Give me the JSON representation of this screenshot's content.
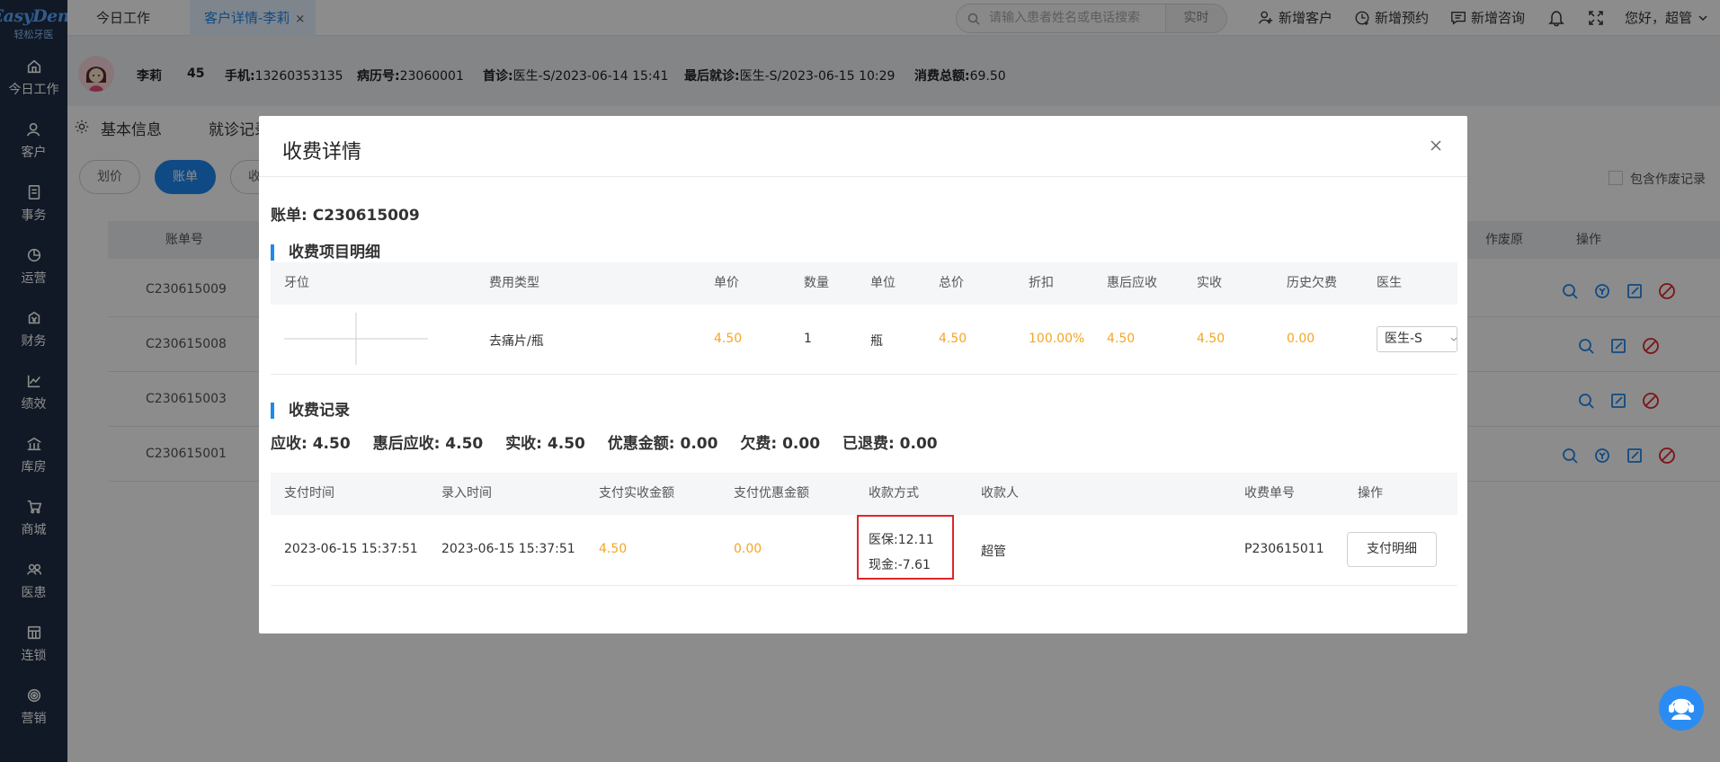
{
  "app": {
    "logo_main": "EasyDent",
    "logo_sub": "轻松牙医"
  },
  "sidebar": {
    "items": [
      {
        "label": "今日工作",
        "icon": "home-icon"
      },
      {
        "label": "客户",
        "icon": "customer-icon"
      },
      {
        "label": "事务",
        "icon": "tasks-icon"
      },
      {
        "label": "运营",
        "icon": "operations-icon"
      },
      {
        "label": "财务",
        "icon": "finance-icon"
      },
      {
        "label": "绩效",
        "icon": "performance-icon"
      },
      {
        "label": "库房",
        "icon": "warehouse-icon"
      },
      {
        "label": "商城",
        "icon": "mall-icon"
      },
      {
        "label": "医患",
        "icon": "doctor-patient-icon"
      },
      {
        "label": "连锁",
        "icon": "chain-icon"
      },
      {
        "label": "营销",
        "icon": "marketing-icon"
      }
    ]
  },
  "topbar": {
    "tab_home": "今日工作",
    "tab_active": "客户详情-李莉",
    "tab_close": "×",
    "search_placeholder": "请输入患者姓名或电话搜索",
    "search_mode": "实时",
    "add_customer": "新增客户",
    "add_appointment": "新增预约",
    "add_consult": "新增咨询",
    "greeting": "您好，超管"
  },
  "patient": {
    "name": "李莉",
    "age": "45",
    "phone_label": "手机:",
    "phone": "13260353135",
    "record_label": "病历号:",
    "record_no": "23060001",
    "first_visit_label": "首诊:",
    "first_visit": "医生-S/2023-06-14 15:41",
    "last_visit_label": "最后就诊:",
    "last_visit": "医生-S/2023-06-15 10:29",
    "total_label": "消费总额:",
    "total": "69.50"
  },
  "background": {
    "tabs": [
      "基本信息",
      "就诊记录"
    ],
    "pills": [
      "划价",
      "账单",
      "收"
    ],
    "include_void": "包含作废记录",
    "columns": [
      "账单号",
      "作废原",
      "操作"
    ],
    "rows": [
      "C230615009",
      "C230615008",
      "C230615003",
      "C230615001"
    ]
  },
  "modal": {
    "title": "收费详情",
    "bill_label": "账单: C230615009",
    "items_section": "收费项目明细",
    "items_columns": [
      "牙位",
      "费用类型",
      "单价",
      "数量",
      "单位",
      "总价",
      "折扣",
      "惠后应收",
      "实收",
      "历史欠费",
      "医生"
    ],
    "item": {
      "fee_type": "去痛片/瓶",
      "unit_price": "4.50",
      "quantity": "1",
      "unit": "瓶",
      "total": "4.50",
      "discount": "100.00%",
      "after_discount": "4.50",
      "received": "4.50",
      "history_debt": "0.00",
      "doctor": "医生-S"
    },
    "records_section": "收费记录",
    "summary": {
      "receivable": "应收: 4.50",
      "after_discount": "惠后应收: 4.50",
      "received": "实收: 4.50",
      "discount_amount": "优惠金额: 0.00",
      "debt": "欠费: 0.00",
      "refunded": "已退费: 0.00"
    },
    "records_columns": [
      "支付时间",
      "录入时间",
      "支付实收金额",
      "支付优惠金额",
      "收款方式",
      "收款人",
      "收费单号",
      "操作"
    ],
    "record": {
      "pay_time": "2023-06-15 15:37:51",
      "entry_time": "2023-06-15 15:37:51",
      "pay_amount": "4.50",
      "pay_discount": "0.00",
      "method_1": "医保:12.11",
      "method_2": "现金:-7.61",
      "payee": "超管",
      "receipt_no": "P230615011",
      "action": "支付明细"
    }
  },
  "colors": {
    "sidebar_bg": "#1f2f46",
    "accent": "#1e88f0",
    "amount": "#f5a623",
    "highlight_box": "#e0252a",
    "danger": "#e0252a"
  }
}
